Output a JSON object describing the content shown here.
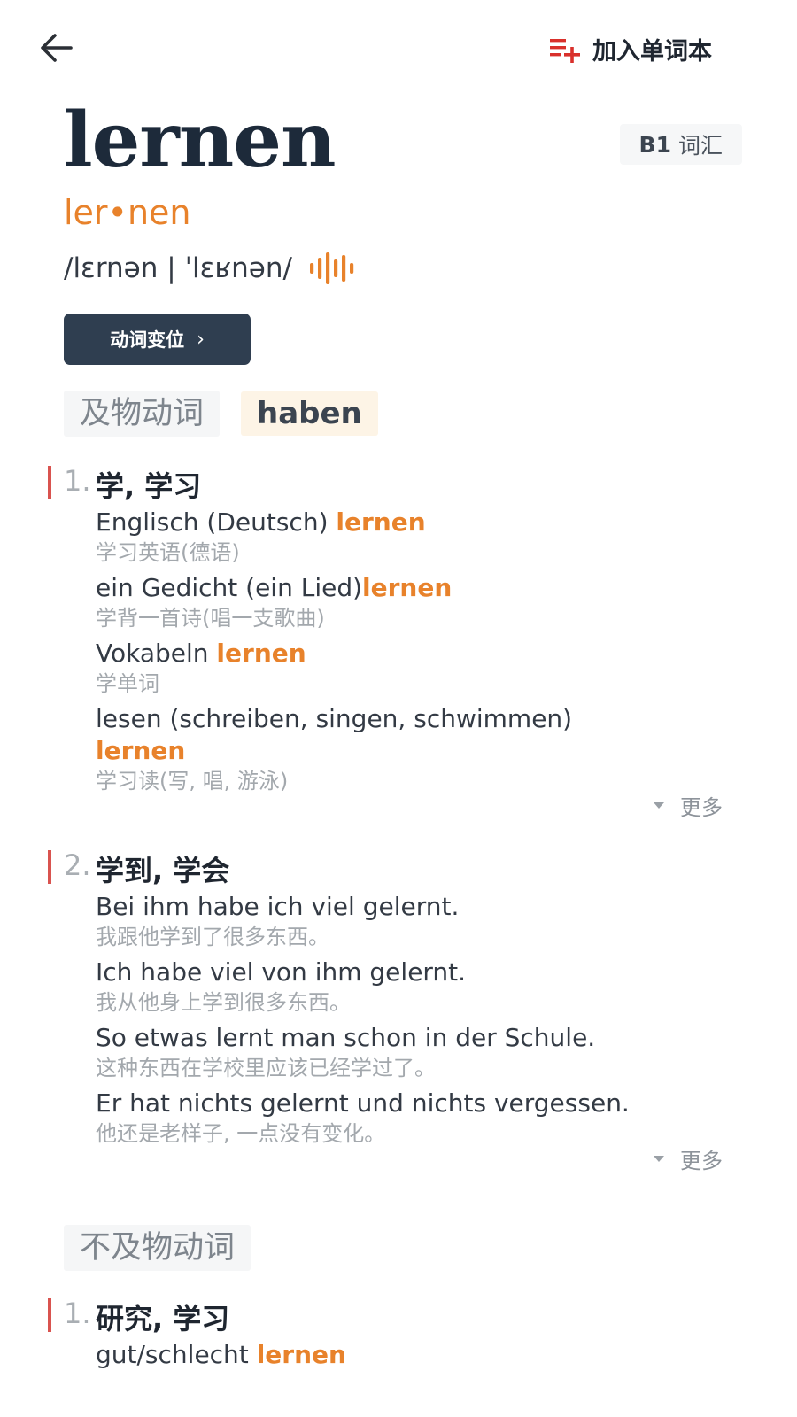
{
  "header": {
    "back_icon": "arrow-left-icon",
    "add_wordbook_icon": "playlist-add-icon",
    "add_wordbook_label": "加入单词本",
    "accent_red": "#d9302b"
  },
  "entry": {
    "word": "lernen",
    "level": "B1",
    "level_label": "词汇",
    "syllables": "ler•nen",
    "ipa": "/lɛrnən | ˈlɛʁnən/",
    "audio_icon": "sound-wave-icon",
    "conjugation_button": "动词变位",
    "conjugation_chevron": "›"
  },
  "sections": [
    {
      "pos": "及物动词",
      "aux": "haben",
      "senses": [
        {
          "num": "1.",
          "title": "学, 学习",
          "more": "更多",
          "examples": [
            {
              "de_before": "Englisch (Deutsch) ",
              "de_hl": "lernen",
              "de_after": "",
              "zh": "学习英语(德语)"
            },
            {
              "de_before": "ein Gedicht (ein Lied)",
              "de_hl": "lernen",
              "de_after": "",
              "zh": "学背一首诗(唱一支歌曲)"
            },
            {
              "de_before": "Vokabeln ",
              "de_hl": "lernen",
              "de_after": "",
              "zh": "学单词"
            },
            {
              "de_before": "lesen (schreiben, singen, schwimmen)",
              "de_hl": "lernen",
              "de_after": "",
              "zh": "学习读(写, 唱, 游泳)"
            }
          ]
        },
        {
          "num": "2.",
          "title": "学到, 学会",
          "more": "更多",
          "examples": [
            {
              "de_before": "Bei ihm habe ich viel gelernt.",
              "de_hl": "",
              "de_after": "",
              "zh": "我跟他学到了很多东西。"
            },
            {
              "de_before": "Ich habe viel von ihm gelernt.",
              "de_hl": "",
              "de_after": "",
              "zh": "我从他身上学到很多东西。"
            },
            {
              "de_before": "So etwas lernt man schon in der Schule.",
              "de_hl": "",
              "de_after": "",
              "zh": "这种东西在学校里应该已经学过了。"
            },
            {
              "de_before": "Er hat nichts gelernt und nichts vergessen.",
              "de_hl": "",
              "de_after": "",
              "zh": "他还是老样子, 一点没有变化。"
            }
          ]
        }
      ]
    },
    {
      "pos": "不及物动词",
      "senses": [
        {
          "num": "1.",
          "title": "研究, 学习",
          "examples": [
            {
              "de_before": "gut/schlecht ",
              "de_hl": "lernen",
              "de_after": "",
              "zh": ""
            }
          ]
        }
      ]
    }
  ]
}
